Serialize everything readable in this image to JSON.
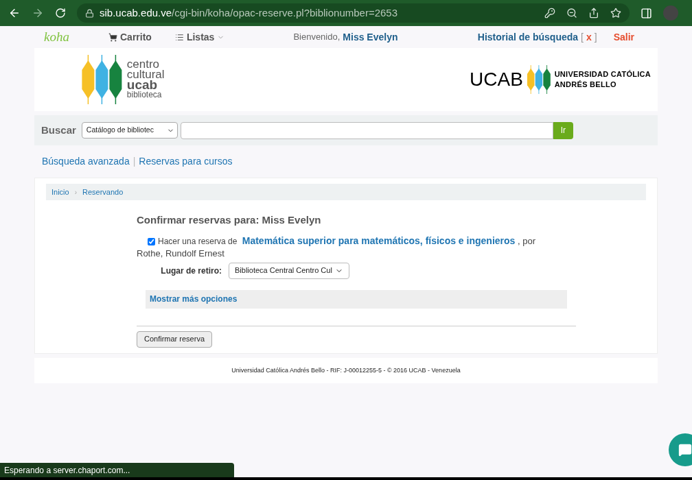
{
  "browser": {
    "url_host": "sib.ucab.edu.ve",
    "url_path": "/cgi-bin/koha/opac-reserve.pl?biblionumber=2653"
  },
  "navbar": {
    "logo": "koha",
    "cart": "Carrito",
    "lists": "Listas",
    "welcome": "Bienvenido,",
    "user": "Miss Evelyn",
    "history": "Historial de búsqueda",
    "history_open": "[",
    "history_clear": "x",
    "history_close": "]",
    "logout": "Salir"
  },
  "header": {
    "logo_lines": [
      "centro",
      "cultural",
      "ucab",
      "biblioteca"
    ],
    "uni_short": "UCAB",
    "uni_lines": [
      "UNIVERSIDAD CATÓLICA",
      "ANDRÉS BELLO"
    ]
  },
  "search": {
    "label": "Buscar",
    "scope": "Catálogo de bibliotec",
    "button": "Ir"
  },
  "links": [
    "Búsqueda avanzada",
    "Reservas para cursos"
  ],
  "links_separator": "|",
  "breadcrumbs": [
    "Inicio",
    "Reservando"
  ],
  "breadcrumb_separator": "›",
  "hold": {
    "heading": "Confirmar reservas para: Miss Evelyn",
    "checked": true,
    "prefix": "Hacer una reserva de",
    "title": "Matemática superior para matemáticos, físicos e ingenieros",
    "suffix": ", por",
    "author": "Rothe, Rundolf Ernest",
    "pickup_label": "Lugar de retiro:",
    "pickup_value": "Biblioteca Central Centro Cul",
    "more_options": "Mostrar más opciones",
    "confirm": "Confirmar reserva"
  },
  "footer": "Universidad Católica Andrés Bello - RIF: J-00012255-5 - © 2016 UCAB - Venezuela",
  "status": "Esperando a server.chaport.com..."
}
